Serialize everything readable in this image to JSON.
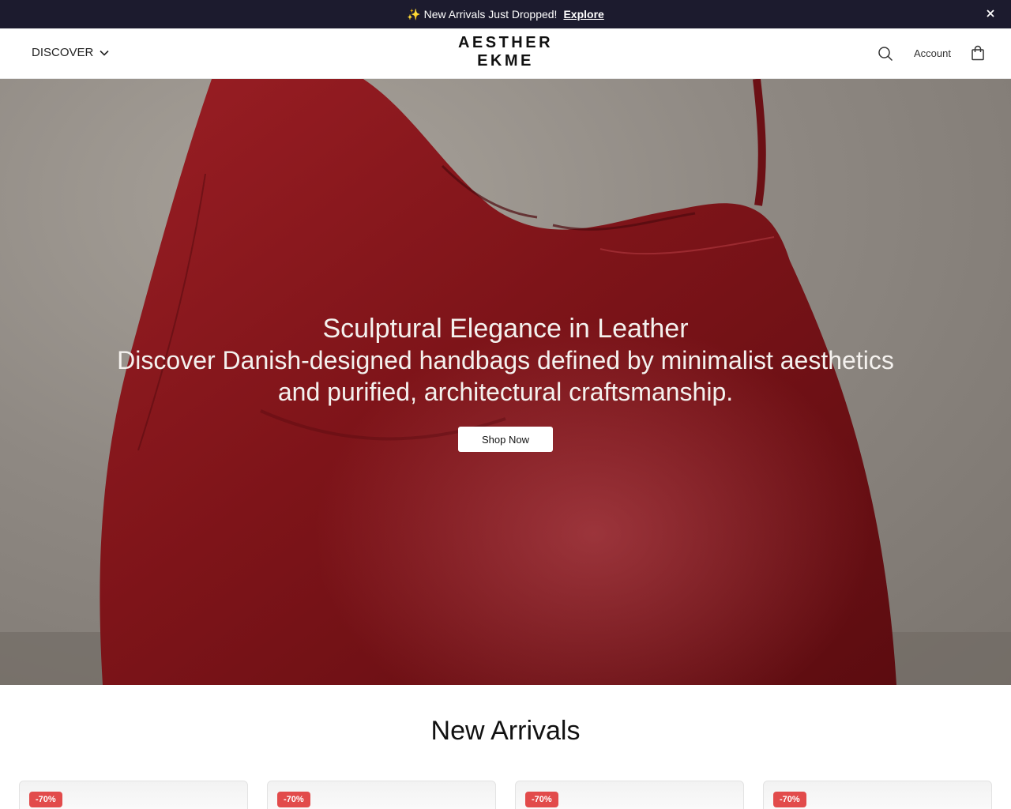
{
  "announcement": {
    "sparkle": "✨",
    "text": "New Arrivals Just Dropped!",
    "link": "Explore"
  },
  "header": {
    "menu_label": "DISCOVER",
    "brand": "AESTHER EKME",
    "account_label": "Account"
  },
  "hero": {
    "title": "Sculptural Elegance in Leather",
    "subtitle": "Discover Danish-designed handbags defined by minimalist aesthetics and purified, architectural craftsmanship.",
    "cta": "Shop Now"
  },
  "new_arrivals": {
    "title": "New Arrivals",
    "products": [
      {
        "badge": "-70%"
      },
      {
        "badge": "-70%"
      },
      {
        "badge": "-70%"
      },
      {
        "badge": "-70%"
      }
    ]
  },
  "colors": {
    "announcement_bg": "#1c1b2e",
    "badge": "#e24b4b",
    "bag_leather": "#8b1a1f"
  },
  "icons": [
    "sparkle-icon",
    "close-icon",
    "chevron-down-icon",
    "search-icon",
    "bag-icon"
  ]
}
